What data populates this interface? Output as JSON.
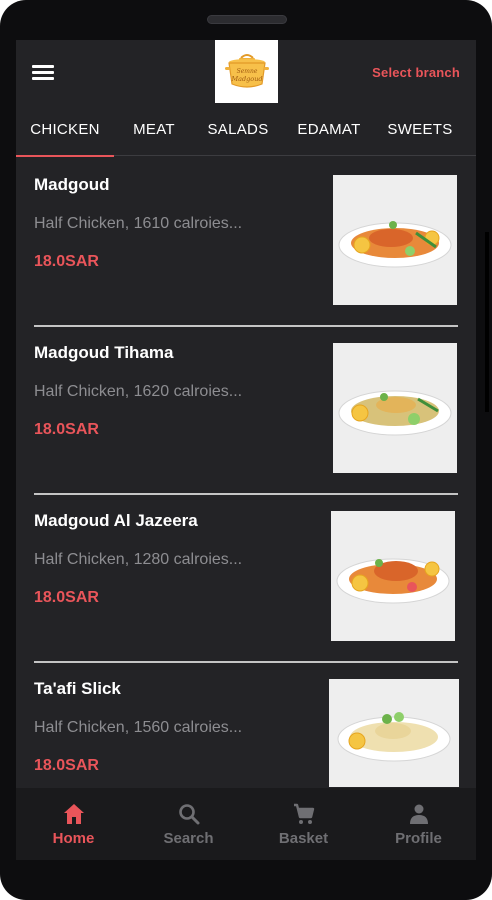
{
  "header": {
    "select_branch": "Select branch",
    "logo_text_line1": "Semne",
    "logo_text_line2": "Madgoud"
  },
  "tabs": [
    {
      "label": "CHICKEN",
      "active": true
    },
    {
      "label": "MEAT",
      "active": false
    },
    {
      "label": "SALADS",
      "active": false
    },
    {
      "label": "EDAMAT",
      "active": false
    },
    {
      "label": "SWEETS",
      "active": false
    }
  ],
  "menu_items": [
    {
      "name": "Madgoud",
      "description": "Half Chicken, 1610 calroies...",
      "price": "18.0SAR",
      "image": "madgoud-chicken-rice-plate"
    },
    {
      "name": "Madgoud Tihama",
      "description": "Half Chicken, 1620 calroies...",
      "price": "18.0SAR",
      "image": "tihama-chicken-rice-plate"
    },
    {
      "name": "Madgoud Al Jazeera",
      "description": "Half Chicken, 1280 calroies...",
      "price": "18.0SAR",
      "image": "al-jazeera-chicken-rice-plate"
    },
    {
      "name": "Ta'afi Slick",
      "description": "Half Chicken, 1560 calroies...",
      "price": "18.0SAR",
      "image": "taafi-chicken-rice-plate"
    }
  ],
  "bottom_nav": [
    {
      "label": "Home",
      "icon": "home-icon",
      "active": true
    },
    {
      "label": "Search",
      "icon": "search-icon",
      "active": false
    },
    {
      "label": "Basket",
      "icon": "cart-icon",
      "active": false
    },
    {
      "label": "Profile",
      "icon": "person-icon",
      "active": false
    }
  ],
  "colors": {
    "accent": "#e9555a",
    "background": "#232326",
    "nav_background": "#1a1a1c",
    "muted_text": "#8d8d91"
  }
}
